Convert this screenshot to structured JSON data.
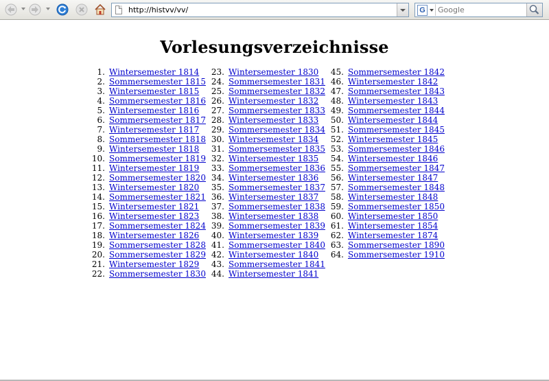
{
  "browser": {
    "url": "http://histvv/vv/",
    "search_placeholder": "Google",
    "search_engine_letter": "G"
  },
  "page": {
    "title": "Vorlesungsverzeichnisse",
    "link_color": "#0000cc",
    "entries": [
      {
        "n": "1.",
        "label": "Wintersemester 1814"
      },
      {
        "n": "2.",
        "label": "Sommersemester 1815"
      },
      {
        "n": "3.",
        "label": "Wintersemester 1815"
      },
      {
        "n": "4.",
        "label": "Sommersemester 1816"
      },
      {
        "n": "5.",
        "label": "Wintersemester 1816"
      },
      {
        "n": "6.",
        "label": "Sommersemester 1817"
      },
      {
        "n": "7.",
        "label": "Wintersemester 1817"
      },
      {
        "n": "8.",
        "label": "Sommersemester 1818"
      },
      {
        "n": "9.",
        "label": "Wintersemester 1818"
      },
      {
        "n": "10.",
        "label": "Sommersemester 1819"
      },
      {
        "n": "11.",
        "label": "Wintersemester 1819"
      },
      {
        "n": "12.",
        "label": "Sommersemester 1820"
      },
      {
        "n": "13.",
        "label": "Wintersemester 1820"
      },
      {
        "n": "14.",
        "label": "Sommersemester 1821"
      },
      {
        "n": "15.",
        "label": "Wintersemester 1821"
      },
      {
        "n": "16.",
        "label": "Wintersemester 1823"
      },
      {
        "n": "17.",
        "label": "Sommersemester 1824"
      },
      {
        "n": "18.",
        "label": "Wintersemester 1826"
      },
      {
        "n": "19.",
        "label": "Sommersemester 1828"
      },
      {
        "n": "20.",
        "label": "Sommersemester 1829"
      },
      {
        "n": "21.",
        "label": "Wintersemester 1829"
      },
      {
        "n": "22.",
        "label": "Sommersemester 1830"
      },
      {
        "n": "23.",
        "label": "Wintersemester 1830"
      },
      {
        "n": "24.",
        "label": "Sommersemester 1831"
      },
      {
        "n": "25.",
        "label": "Sommersemester 1832"
      },
      {
        "n": "26.",
        "label": "Wintersemester 1832"
      },
      {
        "n": "27.",
        "label": "Sommersemester 1833"
      },
      {
        "n": "28.",
        "label": "Wintersemester 1833"
      },
      {
        "n": "29.",
        "label": "Sommersemester 1834"
      },
      {
        "n": "30.",
        "label": "Wintersemester 1834"
      },
      {
        "n": "31.",
        "label": "Sommersemester 1835"
      },
      {
        "n": "32.",
        "label": "Wintersemester 1835"
      },
      {
        "n": "33.",
        "label": "Sommersemester 1836"
      },
      {
        "n": "34.",
        "label": "Wintersemester 1836"
      },
      {
        "n": "35.",
        "label": "Sommersemester 1837"
      },
      {
        "n": "36.",
        "label": "Wintersemester 1837"
      },
      {
        "n": "37.",
        "label": "Sommersemester 1838"
      },
      {
        "n": "38.",
        "label": "Wintersemester 1838"
      },
      {
        "n": "39.",
        "label": "Sommersemester 1839"
      },
      {
        "n": "40.",
        "label": "Wintersemester 1839"
      },
      {
        "n": "41.",
        "label": "Sommersemester 1840"
      },
      {
        "n": "42.",
        "label": "Wintersemester 1840"
      },
      {
        "n": "43.",
        "label": "Sommersemester 1841"
      },
      {
        "n": "44.",
        "label": "Wintersemester 1841"
      },
      {
        "n": "45.",
        "label": "Sommersemester 1842"
      },
      {
        "n": "46.",
        "label": "Wintersemester 1842"
      },
      {
        "n": "47.",
        "label": "Sommersemester 1843"
      },
      {
        "n": "48.",
        "label": "Wintersemester 1843"
      },
      {
        "n": "49.",
        "label": "Sommersemester 1844"
      },
      {
        "n": "50.",
        "label": "Wintersemester 1844"
      },
      {
        "n": "51.",
        "label": "Sommersemester 1845"
      },
      {
        "n": "52.",
        "label": "Wintersemester 1845"
      },
      {
        "n": "53.",
        "label": "Sommersemester 1846"
      },
      {
        "n": "54.",
        "label": "Wintersemester 1846"
      },
      {
        "n": "55.",
        "label": "Sommersemester 1847"
      },
      {
        "n": "56.",
        "label": "Wintersemester 1847"
      },
      {
        "n": "57.",
        "label": "Sommersemester 1848"
      },
      {
        "n": "58.",
        "label": "Wintersemester 1848"
      },
      {
        "n": "59.",
        "label": "Sommersemester 1850"
      },
      {
        "n": "60.",
        "label": "Wintersemester 1850"
      },
      {
        "n": "61.",
        "label": "Wintersemester 1854"
      },
      {
        "n": "62.",
        "label": "Wintersemester 1874"
      },
      {
        "n": "63.",
        "label": "Sommersemester 1890"
      },
      {
        "n": "64.",
        "label": "Sommersemester 1910"
      }
    ]
  }
}
